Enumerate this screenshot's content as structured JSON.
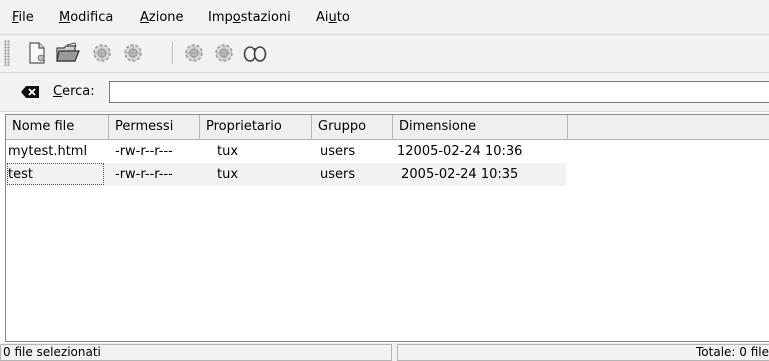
{
  "menubar": {
    "items": [
      {
        "label": "File",
        "mnemonic": "F",
        "rest": "ile"
      },
      {
        "label": "Modifica",
        "mnemonic": "M",
        "rest": "odifica"
      },
      {
        "label": "Azione",
        "mnemonic": "A",
        "rest": "zione"
      },
      {
        "label": "Impostazioni",
        "pre": "Imp",
        "mnemonic": "o",
        "rest": "stazioni"
      },
      {
        "label": "Aiuto",
        "pre": "Ai",
        "mnemonic": "u",
        "rest": "to"
      }
    ]
  },
  "toolbar": {
    "buttons": [
      {
        "icon": "new-file-icon"
      },
      {
        "icon": "open-folder-icon"
      },
      {
        "icon": "network-gear-icon"
      },
      {
        "icon": "network-gear-icon"
      },
      {
        "icon": "network-gear-icon"
      },
      {
        "icon": "network-gear-icon"
      },
      {
        "icon": "binoculars-icon"
      }
    ]
  },
  "search": {
    "label": "Cerca:",
    "mnemonic": "C",
    "rest": "erca:",
    "value": "",
    "placeholder": ""
  },
  "table": {
    "columns": [
      "Nome file",
      "Permessi",
      "Proprietario",
      "Gruppo",
      "Dimensione"
    ],
    "rows": [
      {
        "name": "mytest.html",
        "perms": "-rw-r--r---",
        "owner": "tux",
        "group": "users",
        "size": "12005-02-24 10:36"
      },
      {
        "name": "test",
        "perms": "-rw-r--r---",
        "owner": "tux",
        "group": "users",
        "size": " 2005-02-24 10:35"
      }
    ]
  },
  "status": {
    "left": "0 file selezionati",
    "right": "Totale: 0 file"
  },
  "colors": {
    "chrome": "#f2f2f2",
    "border": "#b5b5b5",
    "alt_row": "#f2f2f2"
  }
}
